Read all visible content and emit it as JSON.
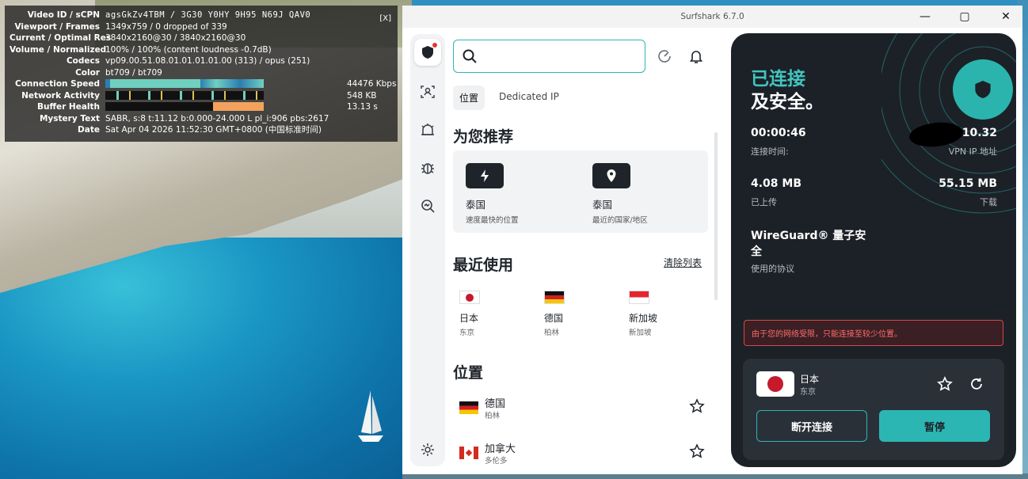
{
  "stats_overlay": {
    "close_label": "[X]",
    "rows": [
      {
        "key": "Video ID / sCPN",
        "value": "agsGkZv4TBM / 3G30 Y0HY 9H95 N69J QAV0"
      },
      {
        "key": "Viewport / Frames",
        "value": "1349x759 / 0 dropped of 339"
      },
      {
        "key": "Current / Optimal Res",
        "value": "3840x2160@30 / 3840x2160@30"
      },
      {
        "key": "Volume / Normalized",
        "value": "100% / 100% (content loudness -0.7dB)"
      },
      {
        "key": "Codecs",
        "value": "vp09.00.51.08.01.01.01.01.00 (313) / opus (251)"
      },
      {
        "key": "Color",
        "value": "bt709 / bt709"
      },
      {
        "key": "Connection Speed",
        "value": "",
        "right": "44476 Kbps"
      },
      {
        "key": "Network Activity",
        "value": "",
        "right": "548 KB"
      },
      {
        "key": "Buffer Health",
        "value": "",
        "right": "13.13 s"
      },
      {
        "key": "Mystery Text",
        "value": "SABR, s:8 t:11.12 b:0.000-24.000 L pl_i:906 pbs:2617"
      },
      {
        "key": "Date",
        "value": "Sat Apr 04 2026 11:52:30 GMT+0800 (中国标准时间)"
      }
    ]
  },
  "window": {
    "title": "Surfshark 6.7.0",
    "minimize": "—",
    "maximize": "▢",
    "close": "✕"
  },
  "rail": {
    "icons": [
      "shield-icon",
      "person-scan-icon",
      "alert-icon",
      "bug-icon",
      "search-web-icon",
      "settings-icon"
    ]
  },
  "search": {
    "placeholder": ""
  },
  "tabs": [
    {
      "label": "位置",
      "active": true
    },
    {
      "label": "Dedicated IP",
      "active": false
    }
  ],
  "recommended": {
    "heading": "为您推荐",
    "items": [
      {
        "title": "泰国",
        "subtitle": "速度最快的位置",
        "icon": "bolt-icon"
      },
      {
        "title": "泰国",
        "subtitle": "最近的国家/地区",
        "icon": "location-pin-icon"
      }
    ]
  },
  "recent": {
    "heading": "最近使用",
    "clear_label": "清除列表",
    "items": [
      {
        "title": "日本",
        "subtitle": "东京",
        "flag": "jp"
      },
      {
        "title": "德国",
        "subtitle": "柏林",
        "flag": "de"
      },
      {
        "title": "新加坡",
        "subtitle": "新加坡",
        "flag": "sg"
      }
    ]
  },
  "locations": {
    "heading": "位置",
    "items": [
      {
        "title": "德国",
        "subtitle": "柏林",
        "flag": "de"
      },
      {
        "title": "加拿大",
        "subtitle": "多伦多",
        "flag": "ca"
      }
    ]
  },
  "status_panel": {
    "status_line1": "已连接",
    "status_line2": "及安全。",
    "connection_time": "00:00:46",
    "connection_time_label": "连接时间:",
    "vpn_ip": ".10.32",
    "vpn_ip_label": "VPN IP 地址",
    "uploaded": "4.08 MB",
    "uploaded_label": "已上传",
    "downloaded": "55.15 MB",
    "downloaded_label": "下载",
    "protocol": "WireGuard® 量子安全",
    "protocol_label": "使用的协议",
    "warning": "由于您的网络受限，只能连接至较少位置。",
    "current_location": {
      "title": "日本",
      "subtitle": "东京"
    },
    "disconnect_label": "断开连接",
    "pause_label": "暂停"
  },
  "colors": {
    "accent": "#2cb6b3",
    "panel_bg": "#1c2127",
    "warning_red": "#d8474a"
  }
}
